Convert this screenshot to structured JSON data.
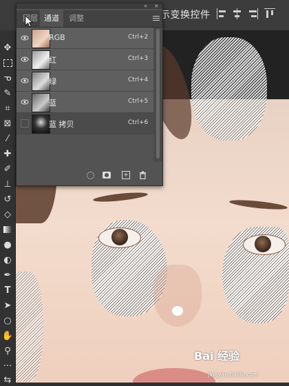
{
  "options_bar": {
    "text": "示变换控件"
  },
  "panel": {
    "tabs": [
      {
        "label": "图层",
        "active": false
      },
      {
        "label": "通道",
        "active": true
      },
      {
        "label": "调整",
        "active": false
      }
    ],
    "header_controls": {
      "collapse": "«",
      "close": "×"
    },
    "channels": [
      {
        "name": "RGB",
        "shortcut": "Ctrl+2",
        "visible": true
      },
      {
        "name": "红",
        "shortcut": "Ctrl+3",
        "visible": true
      },
      {
        "name": "绿",
        "shortcut": "Ctrl+4",
        "visible": true
      },
      {
        "name": "蓝",
        "shortcut": "Ctrl+5",
        "visible": true
      },
      {
        "name": "蓝 拷贝",
        "shortcut": "Ctrl+6",
        "visible": false
      }
    ],
    "footer_icons": [
      "dotted-circle-icon",
      "mask-icon",
      "new-channel-icon",
      "trash-icon"
    ]
  },
  "toolbar": {
    "tools": [
      "move-icon",
      "marquee-icon",
      "lasso-icon",
      "quick-select-icon",
      "crop-icon",
      "frame-icon",
      "eyedropper-icon",
      "healing-icon",
      "brush-icon",
      "stamp-icon",
      "history-brush-icon",
      "eraser-icon",
      "gradient-icon",
      "blur-icon",
      "dodge-icon",
      "pen-icon",
      "type-icon",
      "path-select-icon",
      "ellipse-icon",
      "hand-icon",
      "zoom-icon",
      "more-icon",
      "swap-colors-icon"
    ]
  },
  "watermark": {
    "logo": "Bai 经验",
    "url": "jingyan.baidu.com"
  },
  "colors": {
    "panel_bg": "#535353",
    "app_bg": "#2f2f2f",
    "toolbar_bg": "#323232"
  }
}
